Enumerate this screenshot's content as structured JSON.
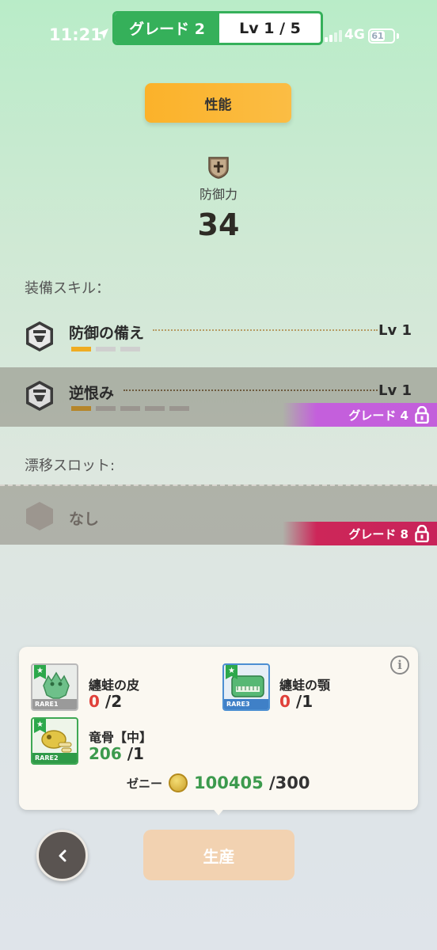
{
  "status": {
    "time": "11:21",
    "network": "4G",
    "battery": "61"
  },
  "header": {
    "grade": "グレード 2",
    "level": "Lv 1 / 5"
  },
  "tab": {
    "label": "性能"
  },
  "defense": {
    "label": "防御力",
    "value": "34",
    "icon": "shield-plus-icon"
  },
  "skills_section": {
    "label": "装備スキル：",
    "skills": [
      {
        "name": "防御の備え",
        "level": "Lv 1",
        "filled": 1,
        "total": 3,
        "locked": false,
        "icon": "skill-badge-icon"
      },
      {
        "name": "逆恨み",
        "level": "Lv 1",
        "filled": 1,
        "total": 5,
        "locked": true,
        "lock_label": "グレード 4",
        "lock_color": "#c45fdc",
        "icon": "skill-badge-icon"
      }
    ]
  },
  "slot_section": {
    "label": "漂移スロット:",
    "slot": {
      "name": "なし",
      "lock_label": "グレード 8",
      "lock_color": "#cd2659"
    }
  },
  "materials": {
    "items": [
      {
        "name": "纏蛙の皮",
        "have": "0",
        "need": "/2",
        "rarity": "RARE1",
        "border": "#b9b9b9"
      },
      {
        "name": "纏蛙の顎",
        "have": "0",
        "need": "/1",
        "rarity": "RARE3",
        "border": "#4c8fd2"
      },
      {
        "name": "竜骨【中】",
        "have": "206",
        "need": "/1",
        "rarity": "RARE2",
        "border": "#3fa854"
      }
    ],
    "zeny": {
      "label": "ゼニー",
      "have": "100405",
      "need": "/300"
    }
  },
  "actions": {
    "back_icon": "chevron-left-icon",
    "produce_label": "生産"
  }
}
